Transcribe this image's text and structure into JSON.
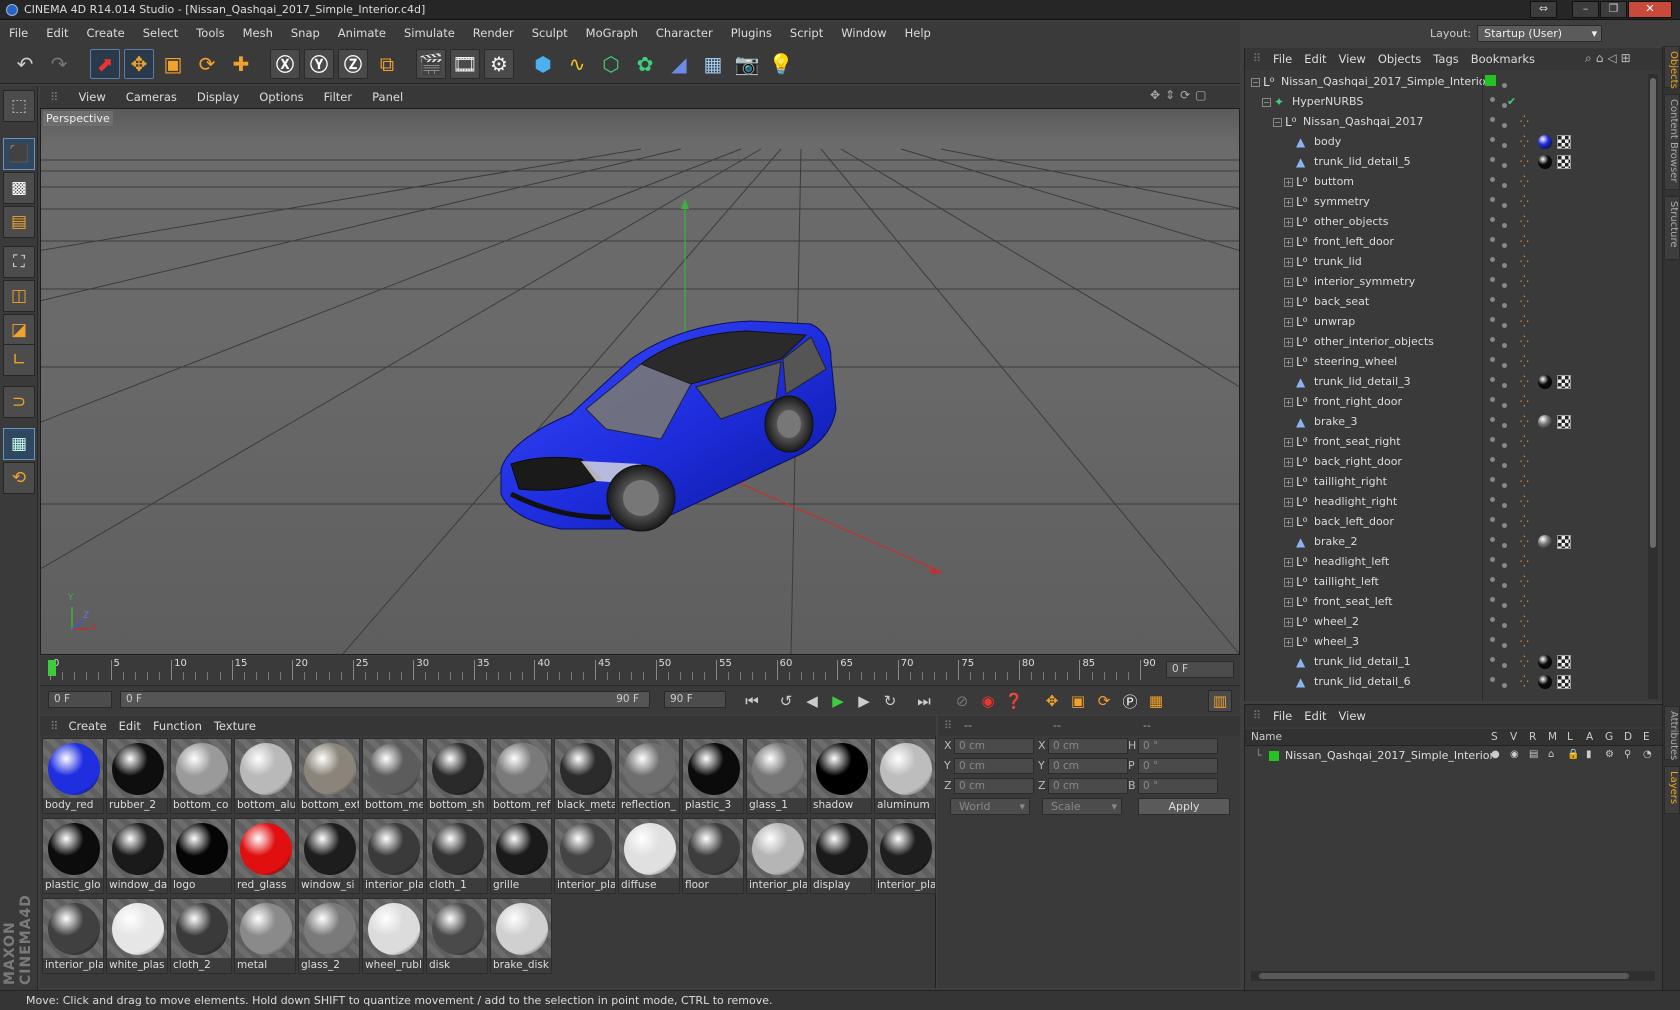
{
  "window": {
    "title": "CINEMA 4D R14.014 Studio - [Nissan_Qashqai_2017_Simple_Interior.c4d]"
  },
  "menubar": [
    "File",
    "Edit",
    "Create",
    "Select",
    "Tools",
    "Mesh",
    "Snap",
    "Animate",
    "Simulate",
    "Render",
    "Sculpt",
    "MoGraph",
    "Character",
    "Plugins",
    "Script",
    "Window",
    "Help"
  ],
  "layout": {
    "label": "Layout:",
    "value": "Startup (User)"
  },
  "toolbar_icons": [
    "undo-icon",
    "redo-icon",
    "live-selection-icon",
    "move-icon",
    "scale-icon",
    "rotate-icon",
    "recent-tool-icon",
    "lock-x-icon",
    "lock-y-icon",
    "lock-z-icon",
    "coordinate-system-icon",
    "render-view-icon",
    "render-picture-viewer-icon",
    "edit-render-settings-icon",
    "cube-icon",
    "spline-pen-icon",
    "subdivision-surface-icon",
    "array-icon",
    "deformer-icon",
    "floor-icon",
    "camera-icon",
    "light-icon"
  ],
  "viewport": {
    "menu": [
      "View",
      "Cameras",
      "Display",
      "Options",
      "Filter",
      "Panel"
    ],
    "label": "Perspective",
    "axis": {
      "y": "Y",
      "x": "X",
      "z": "Z"
    }
  },
  "timeline": {
    "ticks": [
      "0",
      "5",
      "10",
      "15",
      "20",
      "25",
      "30",
      "35",
      "40",
      "45",
      "50",
      "55",
      "60",
      "65",
      "70",
      "75",
      "80",
      "85",
      "90"
    ],
    "current_frame": "0 F"
  },
  "transport": {
    "start": "0 F",
    "slider_start": "0 F",
    "slider_end": "90 F",
    "end": "90 F"
  },
  "material_manager": {
    "menu": [
      "Create",
      "Edit",
      "Function",
      "Texture"
    ],
    "materials": [
      {
        "name": "body_red",
        "color": "#1f2fe0"
      },
      {
        "name": "rubber_2",
        "color": "#0e0e0e"
      },
      {
        "name": "bottom_co",
        "color": "#9a9a9a"
      },
      {
        "name": "bottom_alu",
        "color": "#b9b9b9"
      },
      {
        "name": "bottom_ext",
        "color": "#8a847a"
      },
      {
        "name": "bottom_me",
        "color": "#5c5c5c"
      },
      {
        "name": "bottom_sh",
        "color": "#2a2a2a"
      },
      {
        "name": "bottom_ref",
        "color": "#7a7a7a"
      },
      {
        "name": "black_meta",
        "color": "#2b2b2b"
      },
      {
        "name": "reflection_",
        "color": "#6e6e6e"
      },
      {
        "name": "plastic_3",
        "color": "#0b0b0b"
      },
      {
        "name": "glass_1",
        "color": "#777777"
      },
      {
        "name": "shadow",
        "color": "#000000"
      },
      {
        "name": "aluminum",
        "color": "#bdbdbd"
      },
      {
        "name": "plastic_glo",
        "color": "#0c0c0c"
      },
      {
        "name": "window_da",
        "color": "#1a1a1a"
      },
      {
        "name": "logo",
        "color": "#050505"
      },
      {
        "name": "red_glass",
        "color": "#e01010"
      },
      {
        "name": "window_si",
        "color": "#1d1d1d"
      },
      {
        "name": "interior_pla",
        "color": "#3a3a3a"
      },
      {
        "name": "cloth_1",
        "color": "#333333"
      },
      {
        "name": "grille",
        "color": "#1a1a1a"
      },
      {
        "name": "interior_pla",
        "color": "#444444"
      },
      {
        "name": "diffuse",
        "color": "#e0e0e0"
      },
      {
        "name": "floor",
        "color": "#3d3d3d"
      },
      {
        "name": "interior_pla",
        "color": "#b5b5b5"
      },
      {
        "name": "display",
        "color": "#1a1a1a"
      },
      {
        "name": "interior_pla",
        "color": "#1e1e1e"
      },
      {
        "name": "interior_pla",
        "color": "#404040"
      },
      {
        "name": "white_plas",
        "color": "#e6e6e6"
      },
      {
        "name": "cloth_2",
        "color": "#3a3a3a"
      },
      {
        "name": "metal",
        "color": "#8a8a8a"
      },
      {
        "name": "glass_2",
        "color": "#7a7a7a"
      },
      {
        "name": "wheel_rubl",
        "color": "#dcdcdc"
      },
      {
        "name": "disk",
        "color": "#4a4a4a"
      },
      {
        "name": "brake_disk",
        "color": "#d0d0d0"
      }
    ]
  },
  "coordinates": {
    "headers": [
      "--",
      "--",
      "--"
    ],
    "rows": [
      {
        "a": "X",
        "av": "0 cm",
        "b": "X",
        "bv": "0 cm",
        "c": "H",
        "cv": "0 °"
      },
      {
        "a": "Y",
        "av": "0 cm",
        "b": "Y",
        "bv": "0 cm",
        "c": "P",
        "cv": "0 °"
      },
      {
        "a": "Z",
        "av": "0 cm",
        "b": "Z",
        "bv": "0 cm",
        "c": "B",
        "cv": "0 °"
      }
    ],
    "space": "World",
    "mode": "Scale",
    "apply": "Apply"
  },
  "object_manager": {
    "menu": [
      "File",
      "Edit",
      "View",
      "Objects",
      "Tags",
      "Bookmarks"
    ],
    "objects": [
      {
        "name": "Nissan_Qashqai_2017_Simple_Interior",
        "level": 0,
        "type": "null",
        "expand": "-",
        "tags": "green"
      },
      {
        "name": "HyperNURBS",
        "level": 1,
        "type": "nurbs",
        "expand": "-",
        "tags": "check"
      },
      {
        "name": "Nissan_Qashqai_2017",
        "level": 2,
        "type": "null",
        "expand": "-",
        "tags": "phong"
      },
      {
        "name": "body",
        "level": 3,
        "type": "poly",
        "expand": "",
        "tags": "blue"
      },
      {
        "name": "trunk_lid_detail_5",
        "level": 3,
        "type": "poly",
        "expand": "",
        "tags": "black"
      },
      {
        "name": "buttom",
        "level": 3,
        "type": "null",
        "expand": "+",
        "tags": "phong"
      },
      {
        "name": "symmetry",
        "level": 3,
        "type": "null",
        "expand": "+",
        "tags": "phong"
      },
      {
        "name": "other_objects",
        "level": 3,
        "type": "null",
        "expand": "+",
        "tags": "phong"
      },
      {
        "name": "front_left_door",
        "level": 3,
        "type": "null",
        "expand": "+",
        "tags": "phong"
      },
      {
        "name": "trunk_lid",
        "level": 3,
        "type": "null",
        "expand": "+",
        "tags": "phong"
      },
      {
        "name": "interior_symmetry",
        "level": 3,
        "type": "null",
        "expand": "+",
        "tags": "phong"
      },
      {
        "name": "back_seat",
        "level": 3,
        "type": "null",
        "expand": "+",
        "tags": "phong"
      },
      {
        "name": "unwrap",
        "level": 3,
        "type": "null",
        "expand": "+",
        "tags": "phong"
      },
      {
        "name": "other_interior_objects",
        "level": 3,
        "type": "null",
        "expand": "+",
        "tags": "phong"
      },
      {
        "name": "steering_wheel",
        "level": 3,
        "type": "null",
        "expand": "+",
        "tags": "phong"
      },
      {
        "name": "trunk_lid_detail_3",
        "level": 3,
        "type": "poly",
        "expand": "",
        "tags": "black"
      },
      {
        "name": "front_right_door",
        "level": 3,
        "type": "null",
        "expand": "+",
        "tags": "phong"
      },
      {
        "name": "brake_3",
        "level": 3,
        "type": "poly",
        "expand": "",
        "tags": "grey"
      },
      {
        "name": "front_seat_right",
        "level": 3,
        "type": "null",
        "expand": "+",
        "tags": "phong"
      },
      {
        "name": "back_right_door",
        "level": 3,
        "type": "null",
        "expand": "+",
        "tags": "phong"
      },
      {
        "name": "taillight_right",
        "level": 3,
        "type": "null",
        "expand": "+",
        "tags": "phong"
      },
      {
        "name": "headlight_right",
        "level": 3,
        "type": "null",
        "expand": "+",
        "tags": "phong"
      },
      {
        "name": "back_left_door",
        "level": 3,
        "type": "null",
        "expand": "+",
        "tags": "phong"
      },
      {
        "name": "brake_2",
        "level": 3,
        "type": "poly",
        "expand": "",
        "tags": "grey"
      },
      {
        "name": "headlight_left",
        "level": 3,
        "type": "null",
        "expand": "+",
        "tags": "phong"
      },
      {
        "name": "taillight_left",
        "level": 3,
        "type": "null",
        "expand": "+",
        "tags": "phong"
      },
      {
        "name": "front_seat_left",
        "level": 3,
        "type": "null",
        "expand": "+",
        "tags": "phong"
      },
      {
        "name": "wheel_2",
        "level": 3,
        "type": "null",
        "expand": "+",
        "tags": "phong"
      },
      {
        "name": "wheel_3",
        "level": 3,
        "type": "null",
        "expand": "+",
        "tags": "phong"
      },
      {
        "name": "trunk_lid_detail_1",
        "level": 3,
        "type": "poly",
        "expand": "",
        "tags": "black"
      },
      {
        "name": "trunk_lid_detail_6",
        "level": 3,
        "type": "poly",
        "expand": "",
        "tags": "black"
      }
    ]
  },
  "layer_manager": {
    "menu": [
      "File",
      "Edit",
      "View"
    ],
    "columns": [
      "Name",
      "S",
      "V",
      "R",
      "M",
      "L",
      "A",
      "G",
      "D",
      "E"
    ],
    "layers": [
      {
        "name": "Nissan_Qashqai_2017_Simple_Interior",
        "color": "#22c322"
      }
    ]
  },
  "side_tabs": [
    "Objects",
    "Content Browser",
    "Structure",
    "Attributes",
    "Layers"
  ],
  "statusbar": "Move: Click and drag to move elements. Hold down SHIFT to quantize movement / add to the selection in point mode, CTRL to remove.",
  "colors": {
    "accent": "#f0a21e",
    "selection": "#5a7da5",
    "car": "#1f2fe0"
  }
}
